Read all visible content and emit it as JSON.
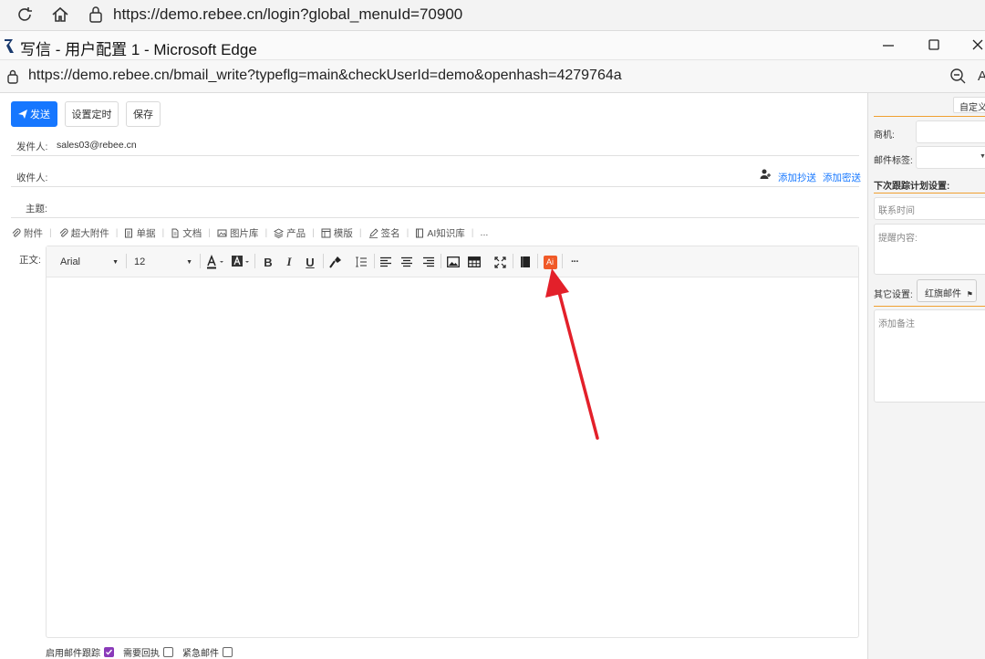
{
  "outer_browser": {
    "url": "https://demo.rebee.cn/login?global_menuId=70900"
  },
  "window": {
    "title": "写信 - 用户配置 1 - Microsoft Edge",
    "url": "https://demo.rebee.cn/bmail_write?typeflg=main&checkUserId=demo&openhash=4279764a"
  },
  "toolbar": {
    "send": "发送",
    "schedule": "设置定时",
    "save": "保存"
  },
  "fields": {
    "sender_label": "发件人:",
    "sender_value": "sales03@rebee.cn",
    "recipient_label": "收件人:",
    "add_cc": "添加抄送",
    "add_bcc": "添加密送",
    "subject_label": "主题:",
    "body_label": "正文:"
  },
  "attach_bar": {
    "attachment": "附件",
    "large_attachment": "超大附件",
    "document_list": "单据",
    "file": "文档",
    "gallery": "图片库",
    "product": "产品",
    "template": "模版",
    "signature": "签名",
    "ai_knowledge": "AI知识库",
    "more": "..."
  },
  "editor": {
    "font_family": "Arial",
    "font_size": "12",
    "ai_badge": "Ai",
    "more": "···"
  },
  "footer": {
    "tracking": "启用邮件跟踪",
    "tracking_checked": true,
    "receipt": "需要回执",
    "receipt_checked": false,
    "urgent": "紧急邮件",
    "urgent_checked": false
  },
  "right_panel": {
    "customize": "自定义",
    "opportunity_label": "商机:",
    "mail_tag_label": "邮件标签:",
    "followup_heading": "下次跟踪计划设置:",
    "contact_time_placeholder": "联系时间",
    "reminder_placeholder": "提醒内容:",
    "other_settings_label": "其它设置:",
    "red_flag_button": "红旗邮件",
    "note_placeholder": "添加备注"
  },
  "colors": {
    "primary": "#1677ff",
    "accent_orange": "#f0a030",
    "ai_badge": "#f05a28",
    "annotation_arrow": "#e3202a",
    "checkbox_checked": "#8a3ab9"
  }
}
